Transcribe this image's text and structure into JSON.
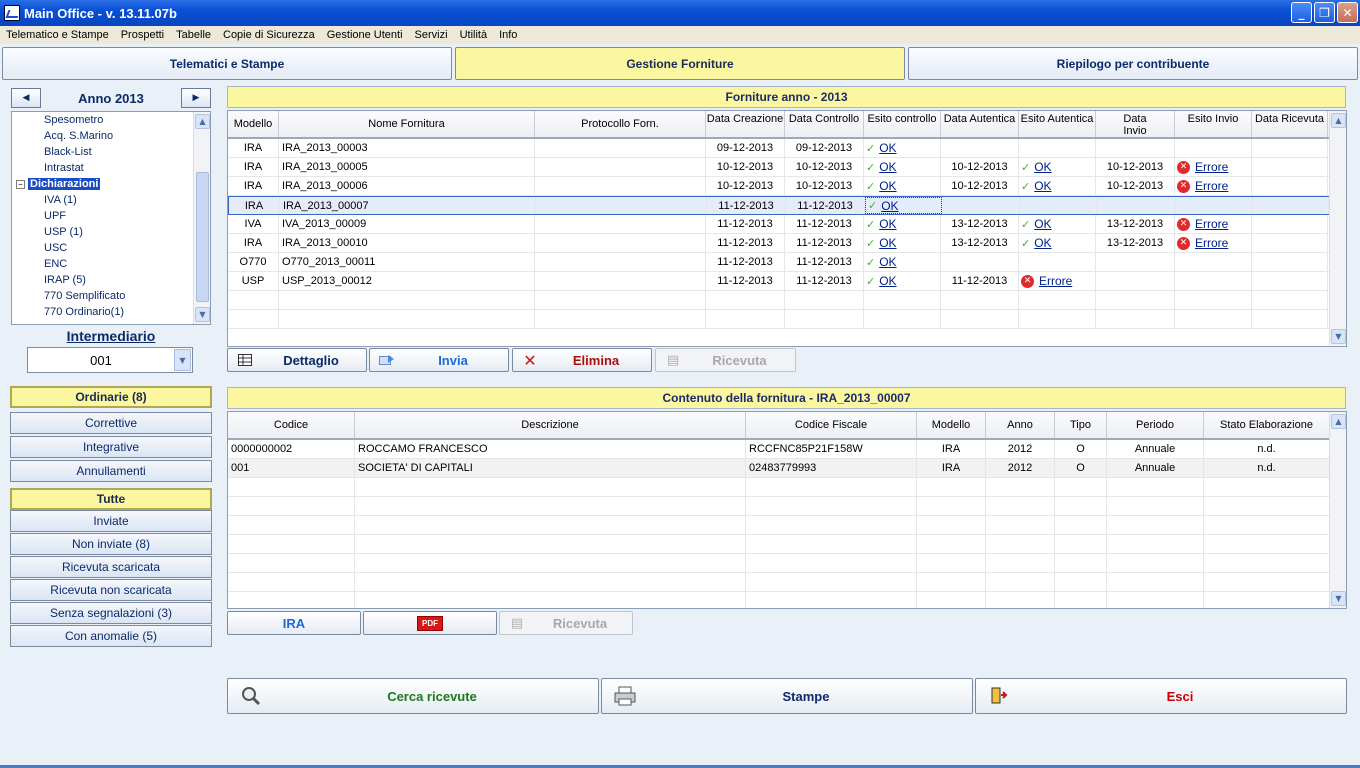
{
  "window": {
    "title": "Main Office - v. 13.11.07b"
  },
  "menu": [
    "Telematico e Stampe",
    "Prospetti",
    "Tabelle",
    "Copie di Sicurezza",
    "Gestione Utenti",
    "Servizi",
    "Utilità",
    "Info"
  ],
  "tabs": {
    "t1": "Telematici e Stampe",
    "t2": "Gestione Forniture",
    "t3": "Riepilogo per contribuente"
  },
  "year": {
    "label": "Anno 2013"
  },
  "tree": {
    "items": [
      "Spesometro",
      "Acq. S.Marino",
      "Black-List",
      "Intrastat"
    ],
    "group": "Dichiarazioni",
    "children": [
      "IVA (1)",
      "UPF",
      "USP (1)",
      "USC",
      "ENC",
      "IRAP (5)",
      "770 Semplificato",
      "770 Ordinario(1)"
    ]
  },
  "intermediario": {
    "label": "Intermediario",
    "value": "001"
  },
  "filters1": {
    "title": "Ordinarie (8)",
    "items": [
      "Correttive",
      "Integrative",
      "Annullamenti"
    ]
  },
  "filters2": {
    "title": "Tutte",
    "items": [
      "Inviate",
      "Non inviate (8)",
      "Ricevuta scaricata",
      "Ricevuta non scaricata",
      "Senza segnalazioni (3)",
      "Con anomalie (5)"
    ]
  },
  "forniture": {
    "title": "Forniture anno - 2013",
    "headers": [
      "Modello",
      "Nome Fornitura",
      "Protocollo Forn.",
      "Data Creazione",
      "Data Controllo",
      "Esito controllo",
      "Data Autentica",
      "Esito Autentica",
      "Data Invio",
      "Esito Invio",
      "Data Ricevuta"
    ],
    "rows": [
      {
        "mod": "IRA",
        "nome": "IRA_2013_00003",
        "prot": "",
        "dcr": "09-12-2013",
        "dco": "09-12-2013",
        "eco": "OK",
        "dau": "",
        "eau": "",
        "din": "",
        "ein": "",
        "dri": ""
      },
      {
        "mod": "IRA",
        "nome": "IRA_2013_00005",
        "prot": "",
        "dcr": "10-12-2013",
        "dco": "10-12-2013",
        "eco": "OK",
        "dau": "10-12-2013",
        "eau": "OK",
        "din": "10-12-2013",
        "ein": "Errore",
        "dri": ""
      },
      {
        "mod": "IRA",
        "nome": "IRA_2013_00006",
        "prot": "",
        "dcr": "10-12-2013",
        "dco": "10-12-2013",
        "eco": "OK",
        "dau": "10-12-2013",
        "eau": "OK",
        "din": "10-12-2013",
        "ein": "Errore",
        "dri": ""
      },
      {
        "mod": "IRA",
        "nome": "IRA_2013_00007",
        "prot": "",
        "dcr": "11-12-2013",
        "dco": "11-12-2013",
        "eco": "OK",
        "dau": "",
        "eau": "",
        "din": "",
        "ein": "",
        "dri": ""
      },
      {
        "mod": "IVA",
        "nome": "IVA_2013_00009",
        "prot": "",
        "dcr": "11-12-2013",
        "dco": "11-12-2013",
        "eco": "OK",
        "dau": "13-12-2013",
        "eau": "OK",
        "din": "13-12-2013",
        "ein": "Errore",
        "dri": ""
      },
      {
        "mod": "IRA",
        "nome": "IRA_2013_00010",
        "prot": "",
        "dcr": "11-12-2013",
        "dco": "11-12-2013",
        "eco": "OK",
        "dau": "13-12-2013",
        "eau": "OK",
        "din": "13-12-2013",
        "ein": "Errore",
        "dri": ""
      },
      {
        "mod": "O770",
        "nome": "O770_2013_00011",
        "prot": "",
        "dcr": "11-12-2013",
        "dco": "11-12-2013",
        "eco": "OK",
        "dau": "",
        "eau": "",
        "din": "",
        "ein": "",
        "dri": ""
      },
      {
        "mod": "USP",
        "nome": "USP_2013_00012",
        "prot": "",
        "dcr": "11-12-2013",
        "dco": "11-12-2013",
        "eco": "OK",
        "dau": "11-12-2013",
        "eau": "Errore",
        "din": "",
        "ein": "",
        "dri": ""
      }
    ],
    "selected": 3
  },
  "actions1": {
    "dettaglio": "Dettaglio",
    "invia": "Invia",
    "elimina": "Elimina",
    "ricevuta": "Ricevuta"
  },
  "contenuto": {
    "title": "Contenuto della fornitura - IRA_2013_00007",
    "headers": [
      "Codice",
      "Descrizione",
      "Codice Fiscale",
      "Modello",
      "Anno",
      "Tipo",
      "Periodo",
      "Stato Elaborazione"
    ],
    "rows": [
      [
        "0000000002",
        "ROCCAMO FRANCESCO",
        "RCCFNC85P21F158W",
        "IRA",
        "2012",
        "O",
        "Annuale",
        "n.d."
      ],
      [
        "001",
        "SOCIETA' DI CAPITALI",
        "02483779993",
        "IRA",
        "2012",
        "O",
        "Annuale",
        "n.d."
      ]
    ]
  },
  "actions2": {
    "ira": "IRA",
    "pdf": "PDF",
    "ricevuta": "Ricevuta"
  },
  "bottom": {
    "cerca": "Cerca ricevute",
    "stampe": "Stampe",
    "esci": "Esci"
  },
  "colors": {
    "accent_yellow": "#fbf7a0",
    "link": "#00208a",
    "exit": "#cc0000",
    "search": "#1a7a1a"
  }
}
